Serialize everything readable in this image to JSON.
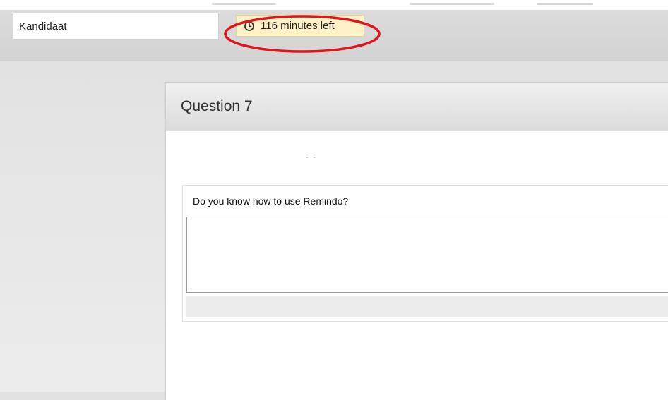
{
  "header": {
    "candidate_label": "Kandidaat",
    "timer_text": "116 minutes left",
    "timer_icon": "clock-icon"
  },
  "question": {
    "title": "Question 7",
    "prompt": "Do you know how to use Remindo?",
    "answer_value": ""
  },
  "colors": {
    "timer_bg": "#fdf1c7",
    "highlight_ring": "#e0141c",
    "page_bg": "#e2e2e2"
  }
}
